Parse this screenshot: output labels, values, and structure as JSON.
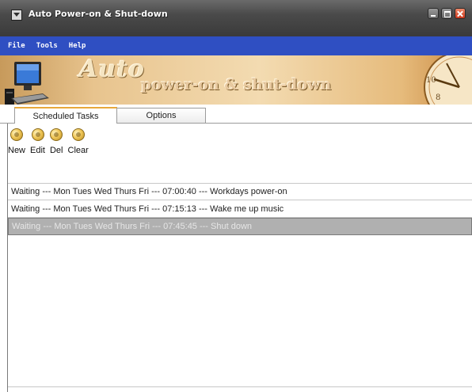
{
  "window": {
    "title": "Auto Power-on & Shut-down"
  },
  "menu": [
    "File",
    "Tools",
    "Help"
  ],
  "banner": {
    "title_line1": "Auto",
    "title_line2": "power-on & shut-down"
  },
  "tabs": [
    {
      "label": "Scheduled Tasks",
      "active": true
    },
    {
      "label": "Options",
      "active": false
    }
  ],
  "toolbar": [
    {
      "label": "New",
      "icon": "new-icon"
    },
    {
      "label": "Edit",
      "icon": "edit-icon"
    },
    {
      "label": "Del",
      "icon": "delete-icon"
    },
    {
      "label": "Clear",
      "icon": "clear-icon"
    }
  ],
  "tasks": [
    {
      "text": "Waiting --- Mon Tues Wed Thurs Fri  --- 07:00:40 --- Workdays power-on",
      "selected": false
    },
    {
      "text": "Waiting --- Mon Tues Wed Thurs Fri  --- 07:15:13 --- Wake me up music",
      "selected": false
    },
    {
      "text": "Waiting --- Mon Tues Wed Thurs Fri  --- 07:45:45 --- Shut down",
      "selected": true
    }
  ],
  "colors": {
    "menubar": "#2f4fc2",
    "selected_row": "#b0b0b0",
    "close_button": "#c8341a"
  }
}
